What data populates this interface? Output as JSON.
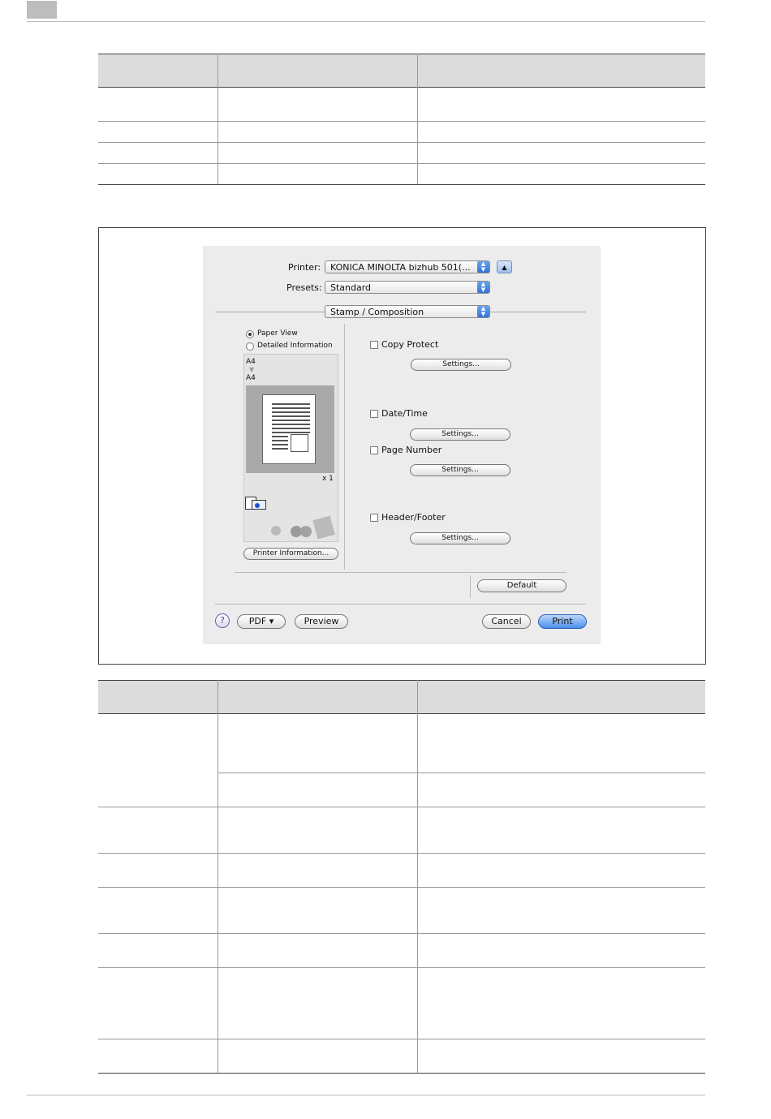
{
  "dialog": {
    "printer_label": "Printer:",
    "printer_value": "KONICA MINOLTA bizhub 501(...",
    "presets_label": "Presets:",
    "presets_value": "Standard",
    "panel_value": "Stamp / Composition",
    "view_options": [
      "Paper View",
      "Detailed Information"
    ],
    "selected_view": "Paper View",
    "paper_from": "A4",
    "paper_to": "A4",
    "copies": "x 1",
    "printer_info_button": "Printer Information...",
    "features": [
      {
        "label": "Copy Protect",
        "checked": false,
        "button": "Settings..."
      },
      {
        "label": "Date/Time",
        "checked": false,
        "button": "Settings..."
      },
      {
        "label": "Page Number",
        "checked": false,
        "button": "Settings..."
      },
      {
        "label": "Header/Footer",
        "checked": false,
        "button": "Settings..."
      }
    ],
    "default_button": "Default",
    "help_glyph": "?",
    "pdf_button": "PDF ▾",
    "preview_button": "Preview",
    "cancel_button": "Cancel",
    "print_button": "Print"
  },
  "colors": {
    "dialog_bg": "#ececec",
    "accent_blue": "#4a8ee8",
    "table_header": "#dcdcdc"
  }
}
